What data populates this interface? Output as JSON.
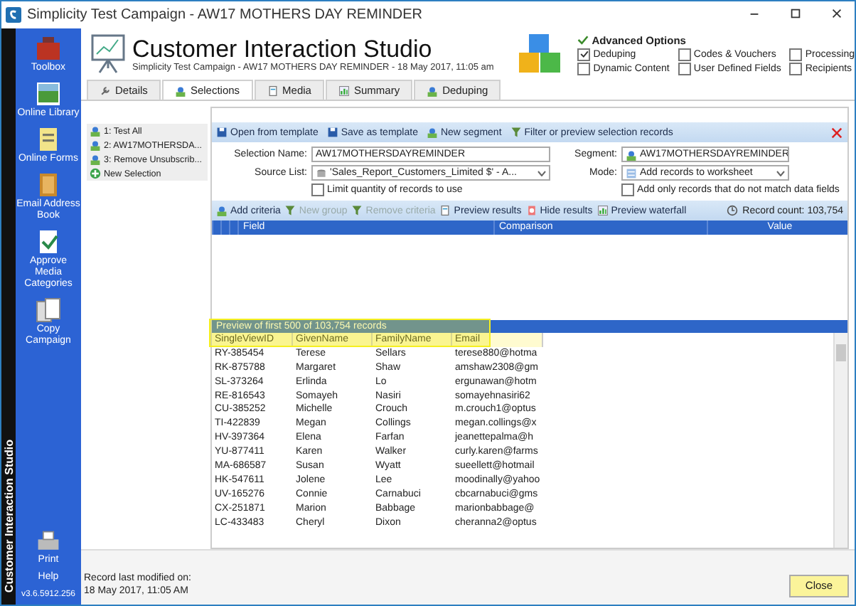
{
  "window": {
    "title": "Simplicity Test Campaign - AW17 MOTHERS DAY REMINDER"
  },
  "side_label": "Customer Interaction Studio",
  "sidebar": {
    "items": [
      {
        "label": "Toolbox",
        "kind": "toolbox"
      },
      {
        "label": "Online Library",
        "kind": "library"
      },
      {
        "label": "Online Forms",
        "kind": "forms"
      },
      {
        "label": "Email Address Book",
        "kind": "book"
      },
      {
        "label": "Approve Media Categories",
        "kind": "approve"
      },
      {
        "label": "Copy Campaign",
        "kind": "copy"
      }
    ],
    "print": "Print",
    "help": "Help",
    "version": "v3.6.5912.256"
  },
  "header": {
    "title": "Customer Interaction Studio",
    "subtitle": "Simplicity Test Campaign - AW17 MOTHERS DAY REMINDER - 18 May 2017, 11:05 am"
  },
  "advanced_options": {
    "title": "Advanced Options",
    "options": [
      {
        "label": "Deduping",
        "checked": true
      },
      {
        "label": "Codes & Vouchers",
        "checked": false
      },
      {
        "label": "Processing",
        "checked": false
      },
      {
        "label": "Dynamic Content",
        "checked": false
      },
      {
        "label": "User Defined Fields",
        "checked": false
      },
      {
        "label": "Recipients",
        "checked": false
      }
    ]
  },
  "tabs": [
    {
      "label": "Details",
      "selected": false
    },
    {
      "label": "Selections",
      "selected": true
    },
    {
      "label": "Media",
      "selected": false
    },
    {
      "label": "Summary",
      "selected": false
    },
    {
      "label": "Deduping",
      "selected": false
    }
  ],
  "selections": [
    {
      "label": "1: Test All",
      "kind": "selection"
    },
    {
      "label": "2:  AW17MOTHERSDA...",
      "kind": "selection"
    },
    {
      "label": "3: Remove Unsubscrib...",
      "kind": "selection"
    },
    {
      "label": "New Selection",
      "kind": "add"
    }
  ],
  "toolbar": [
    "Open from template",
    "Save as template",
    "New segment",
    "Filter or preview selection records"
  ],
  "form": {
    "selection_name_label": "Selection Name:",
    "selection_name": "AW17MOTHERSDAYREMINDER",
    "segment_label": "Segment:",
    "segment": "AW17MOTHERSDAYREMINDER",
    "source_list_label": "Source List:",
    "source_list": "'Sales_Report_Customers_Limited $' - A...",
    "mode_label": "Mode:",
    "mode": "Add records to worksheet",
    "limit": {
      "label": "Limit quantity of records to use",
      "checked": false
    },
    "only_unmatched": {
      "label": "Add only records that do not match data fields",
      "checked": false
    }
  },
  "criteria_toolbar": {
    "buttons": [
      {
        "label": "Add criteria",
        "disabled": false
      },
      {
        "label": "New group",
        "disabled": true
      },
      {
        "label": "Remove criteria",
        "disabled": true
      },
      {
        "label": "Preview results",
        "disabled": false
      },
      {
        "label": "Hide results",
        "disabled": false
      },
      {
        "label": "Preview waterfall",
        "disabled": false
      }
    ],
    "record_count": "Record count: 103,754"
  },
  "criteria_grid": {
    "columns": [
      "Field",
      "Comparison",
      "Value"
    ]
  },
  "preview": {
    "caption": "Preview of first 500 of 103,754 records",
    "columns": [
      "SingleViewID",
      "GivenName",
      "FamilyName",
      "Email"
    ],
    "rows": [
      [
        "RY-385454",
        "Terese",
        "Sellars",
        "terese880@hotma"
      ],
      [
        "RK-875788",
        "Margaret",
        "Shaw",
        "amshaw2308@gm"
      ],
      [
        "SL-373264",
        "Erlinda",
        "Lo",
        "ergunawan@hotm"
      ],
      [
        "RE-816543",
        "Somayeh",
        "Nasiri",
        "somayehnasiri62"
      ],
      [
        "CU-385252",
        "Michelle",
        "Crouch",
        "m.crouch1@optus"
      ],
      [
        "TI-422839",
        "Megan",
        "Collings",
        "megan.collings@x"
      ],
      [
        "HV-397364",
        "Elena",
        "Farfan",
        "jeanettepalma@h"
      ],
      [
        "YU-877411",
        "Karen",
        "Walker",
        "curly.karen@farms"
      ],
      [
        "MA-686587",
        "Susan",
        "Wyatt",
        "sueellett@hotmail"
      ],
      [
        "HK-547611",
        "Jolene",
        "Lee",
        "moodinally@yahoo"
      ],
      [
        "UV-165276",
        "Connie",
        "Carnabuci",
        "cbcarnabuci@gms"
      ],
      [
        "CX-251871",
        "Marion",
        "Babbage",
        "marionbabbage@"
      ],
      [
        "LC-433483",
        "Cheryl",
        "Dixon",
        "cheranna2@optus"
      ]
    ]
  },
  "status": {
    "label": "Record last modified on:",
    "date": "18 May 2017, 11:05 AM"
  },
  "buttons": [
    "Close"
  ]
}
